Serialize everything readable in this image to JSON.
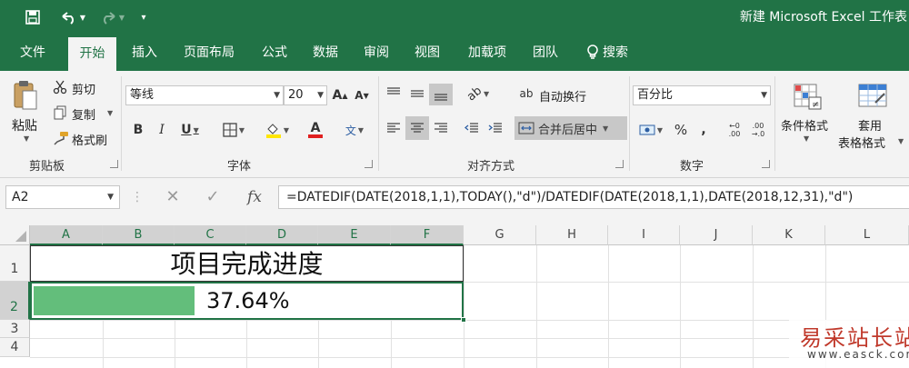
{
  "app": {
    "title": "新建 Microsoft Excel 工作表",
    "accent_color": "#217346",
    "quick_access": [
      "save-icon",
      "undo-icon",
      "redo-icon",
      "customize-icon"
    ]
  },
  "tabs": [
    "文件",
    "开始",
    "插入",
    "页面布局",
    "公式",
    "数据",
    "审阅",
    "视图",
    "加载项",
    "团队",
    "搜索"
  ],
  "active_tab": "开始",
  "ribbon": {
    "clipboard": {
      "paste": "粘贴",
      "cut": "剪切",
      "copy": "复制",
      "format_painter": "格式刷",
      "label": "剪贴板"
    },
    "font": {
      "font_name": "等线",
      "font_size": "20",
      "label": "字体"
    },
    "alignment": {
      "wrap_text": "自动换行",
      "merge_center": "合并后居中",
      "label": "对齐方式"
    },
    "number": {
      "format": "百分比",
      "label": "数字"
    },
    "styles": {
      "conditional_formatting": "条件格式",
      "format_table_line1": "套用",
      "format_table_line2": "表格格式"
    }
  },
  "formula_bar": {
    "name_box": "A2",
    "formula": "=DATEDIF(DATE(2018,1,1),TODAY(),\"d\")/DATEDIF(DATE(2018,1,1),DATE(2018,12,31),\"d\")"
  },
  "sheet": {
    "columns": [
      "A",
      "B",
      "C",
      "D",
      "E",
      "F",
      "G",
      "H",
      "I",
      "J",
      "K",
      "L"
    ],
    "rows": [
      "1",
      "2",
      "3",
      "4"
    ],
    "cells": {
      "A1": "项目完成进度",
      "A2": "37.64%"
    },
    "progress_value": 0.3764,
    "progress_color": "#63be7b"
  },
  "watermark": {
    "main": "易采站长站",
    "sub": "www.easck.com"
  }
}
